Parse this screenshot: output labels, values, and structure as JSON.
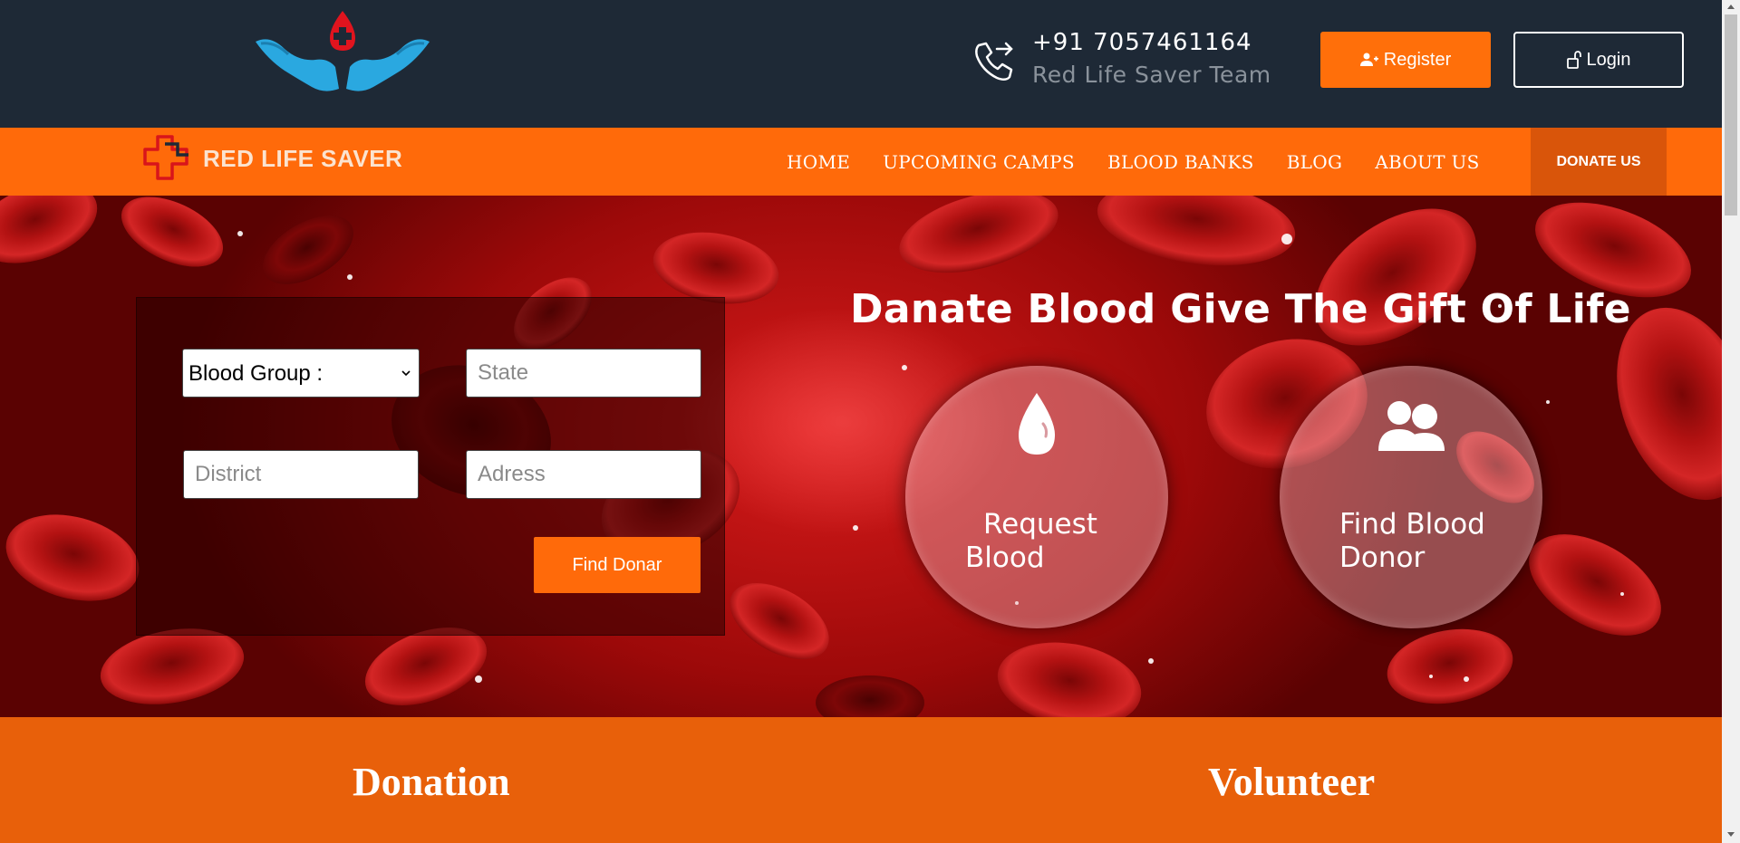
{
  "topbar": {
    "logo": "hands-with-blood-drop-logo",
    "phone_icon": "phone-forward-icon",
    "phone_number": "+91 7057461164",
    "team_name": "Red Life Saver Team",
    "register_label": "Register",
    "register_icon": "user-plus-icon",
    "login_label": "Login",
    "login_icon": "unlock-icon"
  },
  "navbar": {
    "brand_icon": "medical-cross-icon",
    "brand_name": "RED LIFE SAVER",
    "links": [
      "HOME",
      "UPCOMING CAMPS",
      "BLOOD BANKS",
      "BLOG",
      "ABOUT US"
    ],
    "donate_label": "DONATE US"
  },
  "search": {
    "blood_group_selected": "Blood Group :",
    "state_placeholder": "State",
    "district_placeholder": "District",
    "address_placeholder": "Adress",
    "find_label": "Find Donar"
  },
  "hero": {
    "title": "Danate Blood Give The Gift Of Life",
    "request": {
      "icon": "blood-drop-icon",
      "line1": "Request",
      "line2": "Blood"
    },
    "donor": {
      "icon": "users-icon",
      "line1": "Find Blood",
      "line2": "Donor"
    }
  },
  "sections": {
    "donation": "Donation",
    "volunteer": "Volunteer"
  },
  "colors": {
    "topbar_bg": "#1e2936",
    "accent_orange": "#ff6a0a",
    "donate_bg": "#d9550a",
    "hero_red": "#c41212",
    "bottom_band": "#e8600a"
  }
}
